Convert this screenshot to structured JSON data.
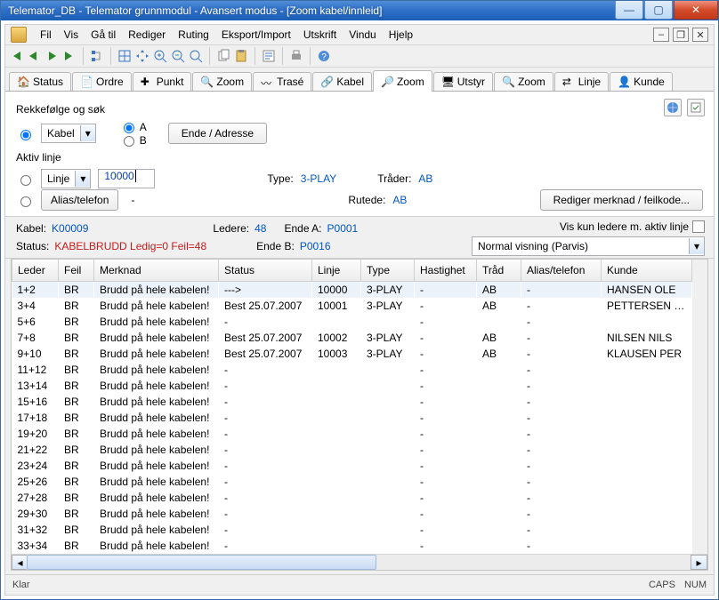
{
  "title": "Telemator_DB - Telemator grunnmodul - Avansert modus - [Zoom kabel/innleid]",
  "menu": [
    "Fil",
    "Vis",
    "Gå til",
    "Rediger",
    "Ruting",
    "Eksport/Import",
    "Utskrift",
    "Vindu",
    "Hjelp"
  ],
  "tabs": [
    "Status",
    "Ordre",
    "Punkt",
    "Zoom",
    "Trasé",
    "Kabel",
    "Zoom",
    "Utstyr",
    "Zoom",
    "Linje",
    "Kunde"
  ],
  "active_tab_index": 6,
  "form": {
    "rekkefolge_label": "Rekkefølge og søk",
    "kabel_label": "Kabel",
    "radio_a": "A",
    "radio_b": "B",
    "ende_adresse_btn": "Ende / Adresse",
    "aktiv_linje_label": "Aktiv linje",
    "linje_btn": "Linje",
    "linje_value": "10000",
    "alias_btn": "Alias/telefon",
    "alias_value": "-",
    "type_label": "Type:",
    "type_value": "3-PLAY",
    "trader_label": "Tråder:",
    "trader_value": "AB",
    "rutede_label": "Rutede:",
    "rutede_value": "AB",
    "rediger_btn": "Rediger merknad / feilkode..."
  },
  "info": {
    "kabel_label": "Kabel:",
    "kabel_value": "K00009",
    "ledere_label": "Ledere:",
    "ledere_value": "48",
    "endeA_label": "Ende A:",
    "endeA_value": "P0001",
    "endeB_label": "Ende B:",
    "endeB_value": "P0016",
    "status_label": "Status:",
    "status_value": "KABELBRUDD Ledig=0 Feil=48",
    "viskun_label": "Vis kun ledere m. aktiv linje",
    "visning_value": "Normal visning (Parvis)"
  },
  "columns": [
    "Leder",
    "Feil",
    "Merknad",
    "Status",
    "Linje",
    "Type",
    "Hastighet",
    "Tråd",
    "Alias/telefon",
    "Kunde"
  ],
  "rows": [
    {
      "leder": "1+2",
      "feil": "BR",
      "merknad": "Brudd på hele kabelen!",
      "status": "--->",
      "linje": "10000",
      "type": "3-PLAY",
      "hastighet": "-",
      "trad": "AB",
      "alias": "-",
      "kunde": "HANSEN OLE"
    },
    {
      "leder": "3+4",
      "feil": "BR",
      "merknad": "Brudd på hele kabelen!",
      "status": "Best 25.07.2007",
      "linje": "10001",
      "type": "3-PLAY",
      "hastighet": "-",
      "trad": "AB",
      "alias": "-",
      "kunde": "PETTERSEN KNUT"
    },
    {
      "leder": "5+6",
      "feil": "BR",
      "merknad": "Brudd på hele kabelen!",
      "status": "-",
      "linje": "",
      "type": "",
      "hastighet": "-",
      "trad": "",
      "alias": "-",
      "kunde": ""
    },
    {
      "leder": "7+8",
      "feil": "BR",
      "merknad": "Brudd på hele kabelen!",
      "status": "Best 25.07.2007",
      "linje": "10002",
      "type": "3-PLAY",
      "hastighet": "-",
      "trad": "AB",
      "alias": "-",
      "kunde": "NILSEN NILS"
    },
    {
      "leder": "9+10",
      "feil": "BR",
      "merknad": "Brudd på hele kabelen!",
      "status": "Best 25.07.2007",
      "linje": "10003",
      "type": "3-PLAY",
      "hastighet": "-",
      "trad": "AB",
      "alias": "-",
      "kunde": "KLAUSEN PER"
    },
    {
      "leder": "11+12",
      "feil": "BR",
      "merknad": "Brudd på hele kabelen!",
      "status": "-",
      "linje": "",
      "type": "",
      "hastighet": "-",
      "trad": "",
      "alias": "-",
      "kunde": ""
    },
    {
      "leder": "13+14",
      "feil": "BR",
      "merknad": "Brudd på hele kabelen!",
      "status": "-",
      "linje": "",
      "type": "",
      "hastighet": "-",
      "trad": "",
      "alias": "-",
      "kunde": ""
    },
    {
      "leder": "15+16",
      "feil": "BR",
      "merknad": "Brudd på hele kabelen!",
      "status": "-",
      "linje": "",
      "type": "",
      "hastighet": "-",
      "trad": "",
      "alias": "-",
      "kunde": ""
    },
    {
      "leder": "17+18",
      "feil": "BR",
      "merknad": "Brudd på hele kabelen!",
      "status": "-",
      "linje": "",
      "type": "",
      "hastighet": "-",
      "trad": "",
      "alias": "-",
      "kunde": ""
    },
    {
      "leder": "19+20",
      "feil": "BR",
      "merknad": "Brudd på hele kabelen!",
      "status": "-",
      "linje": "",
      "type": "",
      "hastighet": "-",
      "trad": "",
      "alias": "-",
      "kunde": ""
    },
    {
      "leder": "21+22",
      "feil": "BR",
      "merknad": "Brudd på hele kabelen!",
      "status": "-",
      "linje": "",
      "type": "",
      "hastighet": "-",
      "trad": "",
      "alias": "-",
      "kunde": ""
    },
    {
      "leder": "23+24",
      "feil": "BR",
      "merknad": "Brudd på hele kabelen!",
      "status": "-",
      "linje": "",
      "type": "",
      "hastighet": "-",
      "trad": "",
      "alias": "-",
      "kunde": ""
    },
    {
      "leder": "25+26",
      "feil": "BR",
      "merknad": "Brudd på hele kabelen!",
      "status": "-",
      "linje": "",
      "type": "",
      "hastighet": "-",
      "trad": "",
      "alias": "-",
      "kunde": ""
    },
    {
      "leder": "27+28",
      "feil": "BR",
      "merknad": "Brudd på hele kabelen!",
      "status": "-",
      "linje": "",
      "type": "",
      "hastighet": "-",
      "trad": "",
      "alias": "-",
      "kunde": ""
    },
    {
      "leder": "29+30",
      "feil": "BR",
      "merknad": "Brudd på hele kabelen!",
      "status": "-",
      "linje": "",
      "type": "",
      "hastighet": "-",
      "trad": "",
      "alias": "-",
      "kunde": ""
    },
    {
      "leder": "31+32",
      "feil": "BR",
      "merknad": "Brudd på hele kabelen!",
      "status": "-",
      "linje": "",
      "type": "",
      "hastighet": "-",
      "trad": "",
      "alias": "-",
      "kunde": ""
    },
    {
      "leder": "33+34",
      "feil": "BR",
      "merknad": "Brudd på hele kabelen!",
      "status": "-",
      "linje": "",
      "type": "",
      "hastighet": "-",
      "trad": "",
      "alias": "-",
      "kunde": ""
    }
  ],
  "statusbar": {
    "left": "Klar",
    "caps": "CAPS",
    "num": "NUM"
  }
}
